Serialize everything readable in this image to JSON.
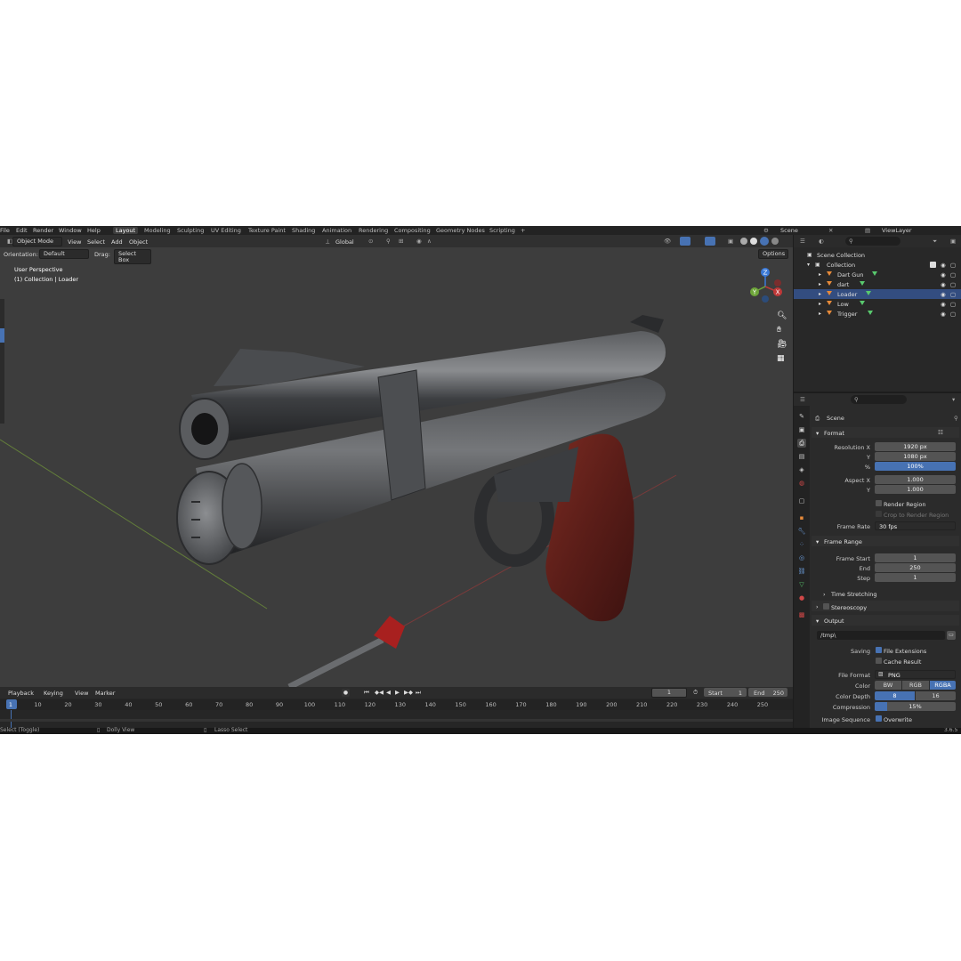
{
  "menubar": {
    "items": [
      "File",
      "Edit",
      "Render",
      "Window",
      "Help"
    ],
    "workspaces": [
      "Layout",
      "Modeling",
      "Sculpting",
      "UV Editing",
      "Texture Paint",
      "Shading",
      "Animation",
      "Rendering",
      "Compositing",
      "Geometry Nodes",
      "Scripting"
    ],
    "add_tab": "+",
    "scene_label": "Scene",
    "viewlayer_label": "ViewLayer"
  },
  "viewport": {
    "mode": "Object Mode",
    "menus": [
      "View",
      "Select",
      "Add",
      "Object"
    ],
    "transform_orientation": "Global",
    "orientation_label": "Orientation:",
    "orientation_value": "Default",
    "drag_label": "Drag:",
    "drag_value": "Select Box",
    "options_label": "Options",
    "overlay_line1": "User Perspective",
    "overlay_line2": "(1) Collection | Loader",
    "gizmo": {
      "x": "X",
      "y": "Y",
      "z": "Z"
    }
  },
  "timeline": {
    "menus": [
      "Playback",
      "Keying",
      "View",
      "Marker"
    ],
    "current_frame": "1",
    "start_label": "Start",
    "start_value": "1",
    "end_label": "End",
    "end_value": "250",
    "ruler": [
      "1",
      "10",
      "20",
      "30",
      "40",
      "50",
      "60",
      "70",
      "80",
      "90",
      "100",
      "110",
      "120",
      "130",
      "140",
      "150",
      "160",
      "170",
      "180",
      "190",
      "200",
      "210",
      "220",
      "230",
      "240",
      "250"
    ]
  },
  "statusbar": {
    "hint1": "Select (Toggle)",
    "hint2": "Dolly View",
    "hint3": "Lasso Select",
    "version": "3.6.5"
  },
  "outliner": {
    "root": "Scene Collection",
    "collection": "Collection",
    "items": [
      "Dart Gun",
      "dart",
      "Loader",
      "Low",
      "Trigger"
    ]
  },
  "properties": {
    "context": "Scene",
    "format": {
      "title": "Format",
      "resolution_x_label": "Resolution X",
      "resolution_x": "1920 px",
      "y_label": "Y",
      "resolution_y": "1080 px",
      "percent_label": "%",
      "percent": "100%",
      "aspect_x_label": "Aspect X",
      "aspect_x": "1.000",
      "aspect_y_label": "Y",
      "aspect_y": "1.000",
      "render_region": "Render Region",
      "crop_region": "Crop to Render Region",
      "frame_rate_label": "Frame Rate",
      "frame_rate": "30 fps"
    },
    "frame_range": {
      "title": "Frame Range",
      "start_label": "Frame Start",
      "start": "1",
      "end_label": "End",
      "end": "250",
      "step_label": "Step",
      "step": "1",
      "time_stretching": "Time Stretching",
      "stereoscopy": "Stereoscopy"
    },
    "output": {
      "title": "Output",
      "path": "/tmp\\",
      "saving_label": "Saving",
      "file_extensions": "File Extensions",
      "cache_result": "Cache Result",
      "file_format_label": "File Format",
      "file_format": "PNG",
      "color_label": "Color",
      "color_options": [
        "BW",
        "RGB",
        "RGBA"
      ],
      "color_depth_label": "Color Depth",
      "color_depth_options": [
        "8",
        "16"
      ],
      "compression_label": "Compression",
      "compression": "15%",
      "image_sequence_label": "Image Sequence",
      "overwrite": "Overwrite"
    }
  },
  "colors": {
    "accent": "#4772b3",
    "viewport_bg": "#3d3d3d",
    "object_orange": "#e68a3a",
    "mesh_green": "#59c96e"
  }
}
